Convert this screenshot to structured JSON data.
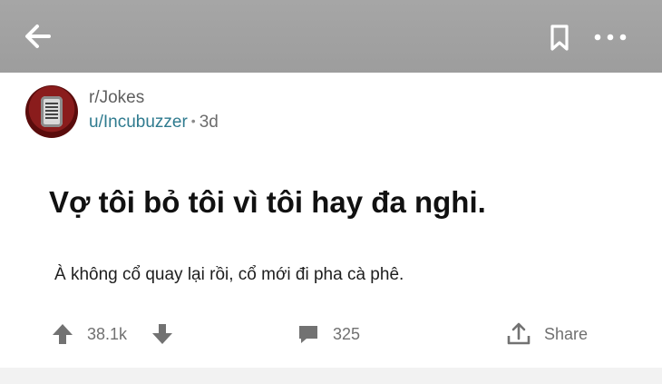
{
  "topbar": {
    "back_icon": "arrow-left-icon",
    "bookmark_icon": "bookmark-icon",
    "more_icon": "more-horizontal-icon",
    "background": "#a3a3a3"
  },
  "post": {
    "subreddit": "r/Jokes",
    "username": "u/Incubuzzer",
    "separator": "•",
    "age": "3d",
    "title": "Vợ tôi bỏ tôi vì tôi hay đa nghi.",
    "body": "À không cổ quay lại rồi, cổ mới đi pha cà phê."
  },
  "actions": {
    "upvote_icon": "arrow-up-icon",
    "score": "38.1k",
    "downvote_icon": "arrow-down-icon",
    "comment_icon": "comment-icon",
    "comments": "325",
    "share_icon": "share-icon",
    "share_label": "Share"
  },
  "colors": {
    "username": "#2f7b8f",
    "action_text": "#707070",
    "title": "#111111"
  }
}
